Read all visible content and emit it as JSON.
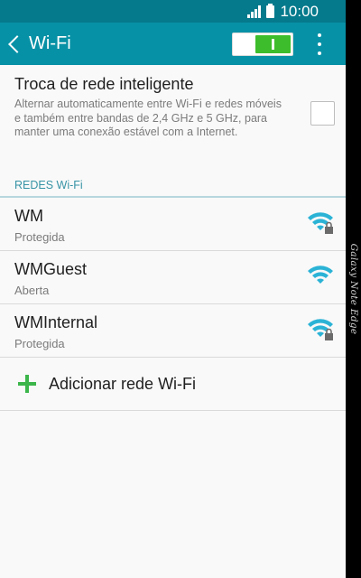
{
  "status_bar": {
    "time": "10:00"
  },
  "action_bar": {
    "back_icon": "chevron-left-icon",
    "title": "Wi-Fi",
    "toggle_on": true
  },
  "smart_switch": {
    "title": "Troca de rede inteligente",
    "description": "Alternar automaticamente entre Wi-Fi e redes móveis e também entre bandas de 2,4 GHz e 5 GHz, para manter uma conexão estável com a Internet.",
    "checked": false
  },
  "networks_header": "REDES Wi-Fi",
  "networks": [
    {
      "name": "WM",
      "status": "Protegida",
      "secured": true
    },
    {
      "name": "WMGuest",
      "status": "Aberta",
      "secured": false
    },
    {
      "name": "WMInternal",
      "status": "Protegida",
      "secured": true
    }
  ],
  "add_network": {
    "label": "Adicionar rede Wi-Fi"
  },
  "edge_label": "Galaxy Note Edge",
  "colors": {
    "status_bar": "#057a8c",
    "action_bar": "#0791a6",
    "wifi_icon": "#2bb3d6",
    "toggle_on": "#3dbd2b",
    "plus": "#3cb64a",
    "section_header": "#3894a6"
  }
}
